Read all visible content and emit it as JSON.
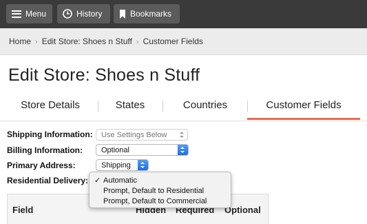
{
  "toolbar": {
    "menu_label": "Menu",
    "history_label": "History",
    "bookmarks_label": "Bookmarks",
    "background": "#3a3a3a"
  },
  "breadcrumb": {
    "items": [
      "Home",
      "Edit Store: Shoes n Stuff",
      "Customer Fields"
    ]
  },
  "page": {
    "title": "Edit Store: Shoes n Stuff"
  },
  "tabs": [
    {
      "label": "Store Details",
      "active": false
    },
    {
      "label": "States",
      "active": false
    },
    {
      "label": "Countries",
      "active": false
    },
    {
      "label": "Customer Fields",
      "active": true
    }
  ],
  "form": {
    "shipping": {
      "label": "Shipping Information:",
      "value": "Use Settings Below",
      "disabled": true
    },
    "billing": {
      "label": "Billing Information:",
      "value": "Optional"
    },
    "primary": {
      "label": "Primary Address:",
      "value": "Shipping"
    },
    "residential": {
      "label": "Residential Delivery:"
    }
  },
  "residential_options": {
    "items": [
      "Automatic",
      "Prompt, Default to Residential",
      "Prompt, Default to Commercial"
    ],
    "selected": "Automatic"
  },
  "table": {
    "headers": [
      "Field",
      "Hidden",
      "Required",
      "Optional"
    ]
  },
  "colors": {
    "accent": "#ef6a55",
    "select_blue": "#1d6fe6"
  }
}
